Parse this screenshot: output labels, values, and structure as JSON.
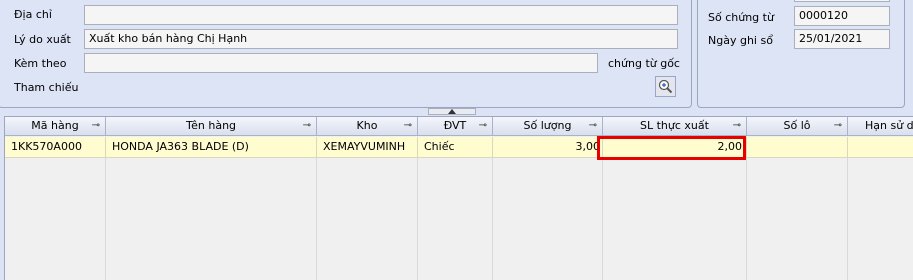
{
  "form": {
    "dia_chi_label": "Địa chỉ",
    "dia_chi_value": "",
    "ly_do_label": "Lý do xuất",
    "ly_do_value": "Xuất kho bán hàng Chị Hạnh",
    "kem_theo_label": "Kèm theo",
    "kem_theo_value": "",
    "chung_tu_goc_label": "chứng từ gốc",
    "tham_chieu_label": "Tham chiếu"
  },
  "right_panel": {
    "so_chung_tu_label": "Số chứng từ",
    "so_chung_tu_value": "0000120",
    "ngay_ghi_so_label": "Ngày ghi sổ",
    "ngay_ghi_so_value": "25/01/2021"
  },
  "grid": {
    "columns": [
      "Mã hàng",
      "Tên hàng",
      "Kho",
      "ĐVT",
      "Số lượng",
      "SL thực xuất",
      "Số lô",
      "Hạn sử dụng"
    ],
    "rows": [
      {
        "ma_hang": "1KK570A000",
        "ten_hang": "HONDA JA363 BLADE (D)",
        "kho": "XEMAYVUMINH",
        "dvt": "Chiếc",
        "so_luong": "3,00",
        "sl_thuc_xuat": "2,00",
        "so_lo": "",
        "han_su_dung": ""
      }
    ]
  },
  "icons": {
    "zoom": "magnifier-plus-icon",
    "pin": "pin-icon",
    "splitter": "chevron-up-icon"
  },
  "colors": {
    "highlight": "#e60000",
    "row_bg": "#fffdd0",
    "panel_bg": "#dde4f6"
  }
}
